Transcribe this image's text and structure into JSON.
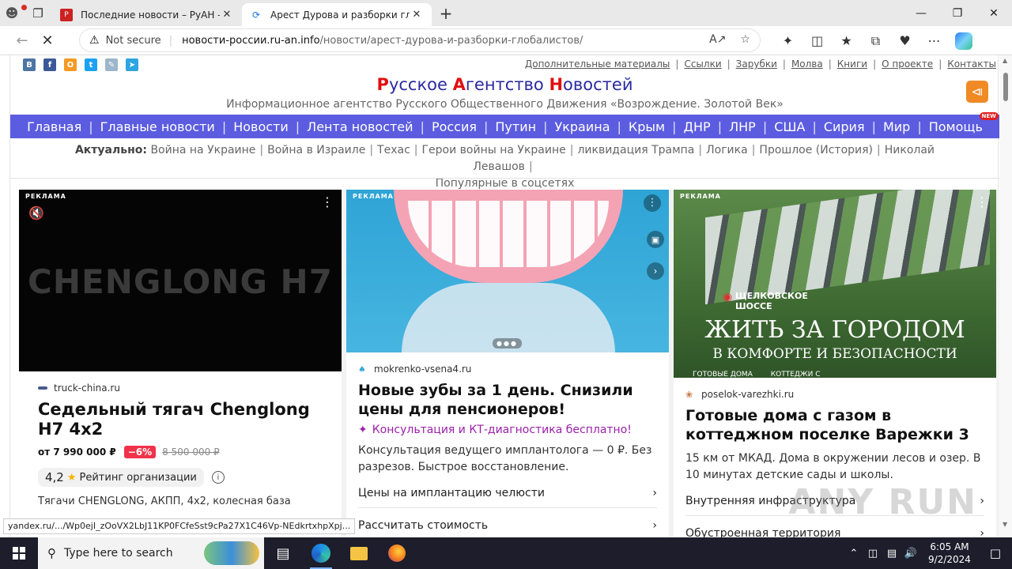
{
  "browser": {
    "tabs": [
      {
        "title": "Последние новости – РуАН – Ру",
        "active": false
      },
      {
        "title": "Арест Дурова и разборки глоба",
        "active": true
      }
    ],
    "not_secure": "Not secure",
    "url_domain": "новости-россии.ru-an.info",
    "url_path": "/новости/арест-дурова-и-разборки-глобалистов/"
  },
  "site": {
    "top_links": [
      "Дополнительные материалы",
      "Ссылки",
      "Зарубки",
      "Молва",
      "Книги",
      "О проекте",
      "Контакты"
    ],
    "logo": {
      "p1": "Р",
      "p2": "усское ",
      "p3": "А",
      "p4": "гентство ",
      "p5": "Н",
      "p6": "овостей"
    },
    "tagline": "Информационное агентство Русского Общественного Движения «Возрождение. Золотой Век»",
    "nav": [
      "Главная",
      "Главные новости",
      "Новости",
      "Лента новостей",
      "Россия",
      "Путин",
      "Украина",
      "Крым",
      "ДНР",
      "ЛНР",
      "США",
      "Сирия",
      "Мир",
      "Помощь"
    ],
    "nav_new_badge": "NEW",
    "actual_label": "Актуально:",
    "actual_links": [
      "Война на Украине",
      "Война в Израиле",
      "Техас",
      "Герои войны на Украине",
      "ликвидация Трампа",
      "Логика",
      "Прошлое (История)",
      "Николай Левашов",
      "Популярные в соцсетях"
    ]
  },
  "ads": [
    {
      "label": "РЕКЛАМА",
      "image_text": "CHENGLONG H7",
      "source": "truck-china.ru",
      "title": "Седельный тягач Chenglong H7 4х2",
      "price": "от 7 990 000 ₽",
      "discount": "−6%",
      "old_price": "8 500 000 ₽",
      "rating": "4,2",
      "rating_label": "Рейтинг организации",
      "desc": "Тягачи CHENGLONG, АКПП, 4х2, колесная база"
    },
    {
      "label": "РЕКЛАМА",
      "source": "mokrenko-vsena4.ru",
      "title": "Новые зубы за 1 день. Снизили цены для пенсионеров!",
      "promo": "Консультация и КТ-диагностика бесплатно!",
      "desc": "Консультация ведущего имплантолога — 0 ₽. Без разрезов. Быстрое восстановление.",
      "links": [
        "Цены на имплантацию челюсти",
        "Рассчитать стоимость"
      ]
    },
    {
      "label": "РЕКЛАМА",
      "image_line0": "ЩЕЛКОВСКОЕ ШОССЕ",
      "image_line1": "ЖИТЬ ЗА ГОРОДОМ",
      "image_line2": "В КОМФОРТЕ И БЕЗОПАСНОСТИ",
      "image_line3": "ГОТОВЫЕ ДОМА        КОТТЕДЖИ С",
      "source": "poselok-varezhki.ru",
      "title": "Готовые дома с газом в коттеджном поселке Варежки 3",
      "desc": "15 км от МКАД. Дома в окружении лесов и озер. В 10 минутах детские сады и школы.",
      "links": [
        "Внутренняя инфраструктура",
        "Обустроенная территория"
      ]
    }
  ],
  "status_url": "yandex.ru/.../Wp0ejI_zOoVX2LbJ11KP0FCfeSst9cPa27X1C46Vp-NEdkrtxhpXpj...",
  "watermark": "ANY RUN",
  "taskbar": {
    "search_placeholder": "Type here to search",
    "time": "6:05 AM",
    "date": "9/2/2024"
  }
}
